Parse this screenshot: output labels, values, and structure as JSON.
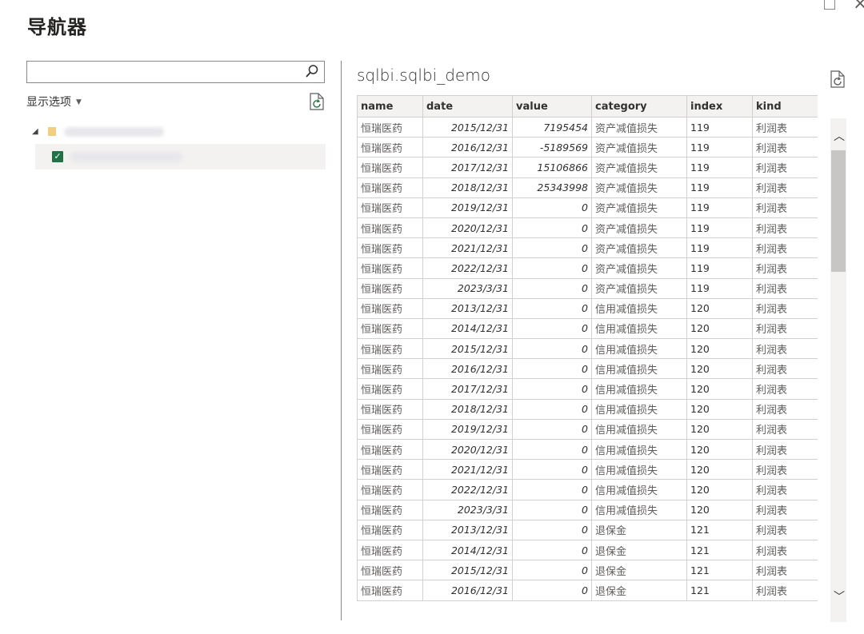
{
  "window": {
    "maximize_icon": "maximize-icon",
    "close_label": "×"
  },
  "title": "导航器",
  "left": {
    "search": {
      "placeholder": "",
      "value": ""
    },
    "display_options": "显示选项",
    "tree": {
      "selected": true
    }
  },
  "table": {
    "title": "sqlbi.sqlbi_demo",
    "columns": [
      "name",
      "date",
      "value",
      "category",
      "index",
      "kind"
    ],
    "rows": [
      [
        "恒瑞医药",
        "2015/12/31",
        "7195454",
        "资产减值损失",
        "119",
        "利润表"
      ],
      [
        "恒瑞医药",
        "2016/12/31",
        "-5189569",
        "资产减值损失",
        "119",
        "利润表"
      ],
      [
        "恒瑞医药",
        "2017/12/31",
        "15106866",
        "资产减值损失",
        "119",
        "利润表"
      ],
      [
        "恒瑞医药",
        "2018/12/31",
        "25343998",
        "资产减值损失",
        "119",
        "利润表"
      ],
      [
        "恒瑞医药",
        "2019/12/31",
        "0",
        "资产减值损失",
        "119",
        "利润表"
      ],
      [
        "恒瑞医药",
        "2020/12/31",
        "0",
        "资产减值损失",
        "119",
        "利润表"
      ],
      [
        "恒瑞医药",
        "2021/12/31",
        "0",
        "资产减值损失",
        "119",
        "利润表"
      ],
      [
        "恒瑞医药",
        "2022/12/31",
        "0",
        "资产减值损失",
        "119",
        "利润表"
      ],
      [
        "恒瑞医药",
        "2023/3/31",
        "0",
        "资产减值损失",
        "119",
        "利润表"
      ],
      [
        "恒瑞医药",
        "2013/12/31",
        "0",
        "信用减值损失",
        "120",
        "利润表"
      ],
      [
        "恒瑞医药",
        "2014/12/31",
        "0",
        "信用减值损失",
        "120",
        "利润表"
      ],
      [
        "恒瑞医药",
        "2015/12/31",
        "0",
        "信用减值损失",
        "120",
        "利润表"
      ],
      [
        "恒瑞医药",
        "2016/12/31",
        "0",
        "信用减值损失",
        "120",
        "利润表"
      ],
      [
        "恒瑞医药",
        "2017/12/31",
        "0",
        "信用减值损失",
        "120",
        "利润表"
      ],
      [
        "恒瑞医药",
        "2018/12/31",
        "0",
        "信用减值损失",
        "120",
        "利润表"
      ],
      [
        "恒瑞医药",
        "2019/12/31",
        "0",
        "信用减值损失",
        "120",
        "利润表"
      ],
      [
        "恒瑞医药",
        "2020/12/31",
        "0",
        "信用减值损失",
        "120",
        "利润表"
      ],
      [
        "恒瑞医药",
        "2021/12/31",
        "0",
        "信用减值损失",
        "120",
        "利润表"
      ],
      [
        "恒瑞医药",
        "2022/12/31",
        "0",
        "信用减值损失",
        "120",
        "利润表"
      ],
      [
        "恒瑞医药",
        "2023/3/31",
        "0",
        "信用减值损失",
        "120",
        "利润表"
      ],
      [
        "恒瑞医药",
        "2013/12/31",
        "0",
        "退保金",
        "121",
        "利润表"
      ],
      [
        "恒瑞医药",
        "2014/12/31",
        "0",
        "退保金",
        "121",
        "利润表"
      ],
      [
        "恒瑞医药",
        "2015/12/31",
        "0",
        "退保金",
        "121",
        "利润表"
      ],
      [
        "恒瑞医药",
        "2016/12/31",
        "0",
        "退保金",
        "121",
        "利润表"
      ]
    ]
  },
  "colors": {
    "checkbox": "#217346",
    "folder": "#f2cf80",
    "scroll_thumb": "#c8c6c4"
  }
}
